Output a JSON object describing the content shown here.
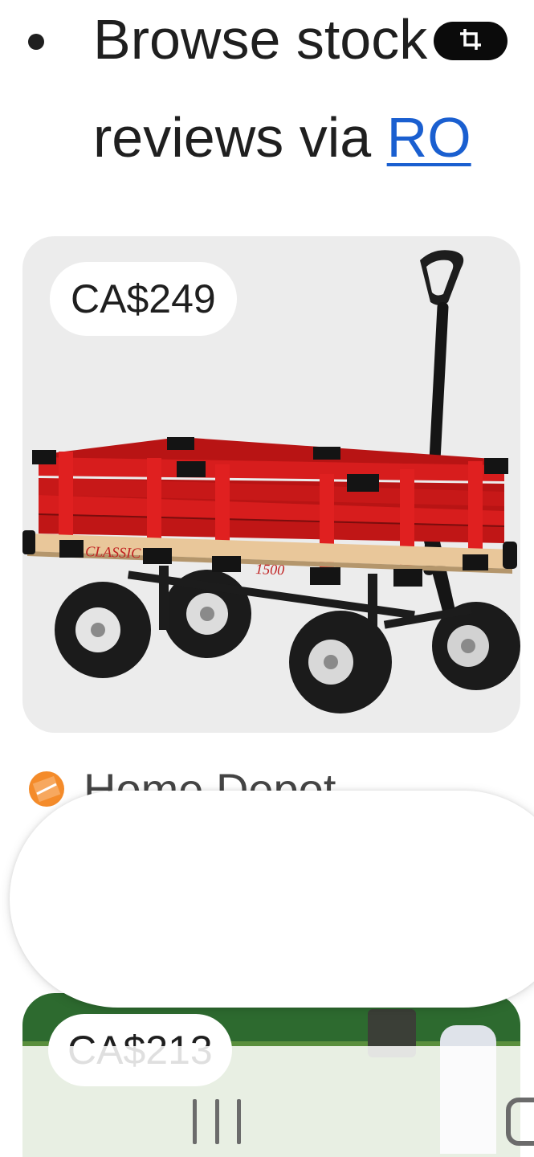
{
  "bullet": {
    "line1": "Browse stock a",
    "line2_prefix": "reviews via ",
    "line2_link": "RO"
  },
  "overlay": {
    "crop_icon": "crop-icon"
  },
  "product_card": {
    "price": "CA$249",
    "image": "red-wooden-wagon"
  },
  "store": {
    "name": "Home Depot",
    "logo_icon": "home-depot-logo"
  },
  "product_card_2": {
    "price": "CA$213"
  },
  "nav": {
    "recent_icon": "recent-apps-icon",
    "home_icon": "home-icon"
  },
  "colors": {
    "link": "#1a5fd0",
    "card_bg": "#ececec",
    "wagon_red": "#d11a1a",
    "store_logo": "#f48b2a"
  }
}
